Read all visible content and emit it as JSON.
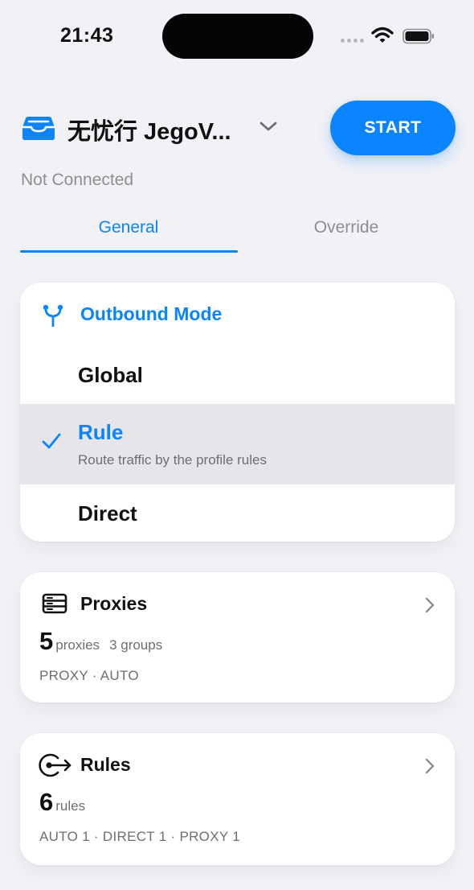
{
  "status_bar": {
    "time": "21:43"
  },
  "header": {
    "profile_name": "无忧行 JegoV...",
    "start_label": "START",
    "connection_status": "Not Connected"
  },
  "tabs": [
    {
      "label": "General",
      "selected": true
    },
    {
      "label": "Override",
      "selected": false
    }
  ],
  "outbound": {
    "title": "Outbound Mode",
    "modes": [
      {
        "label": "Global",
        "selected": false
      },
      {
        "label": "Rule",
        "description": "Route traffic by the profile rules",
        "selected": true
      },
      {
        "label": "Direct",
        "selected": false
      }
    ]
  },
  "proxies": {
    "title": "Proxies",
    "count": "5",
    "unit": "proxies",
    "groups": "3 groups",
    "subline": "PROXY · AUTO"
  },
  "rules": {
    "title": "Rules",
    "count": "6",
    "unit": "rules",
    "subline": "AUTO 1 · DIRECT 1 · PROXY 1"
  },
  "colors": {
    "accent": "#0a84ff",
    "background": "#f2f2f6",
    "selected_row": "#e5e5ea",
    "secondary_text": "#8e8e93"
  },
  "icons": [
    "wifi-icon",
    "battery-icon",
    "inbox-tray-icon",
    "chevron-down-icon",
    "fork-icon",
    "checkmark-icon",
    "server-stack-icon",
    "rules-arrow-icon",
    "chevron-right-icon"
  ]
}
